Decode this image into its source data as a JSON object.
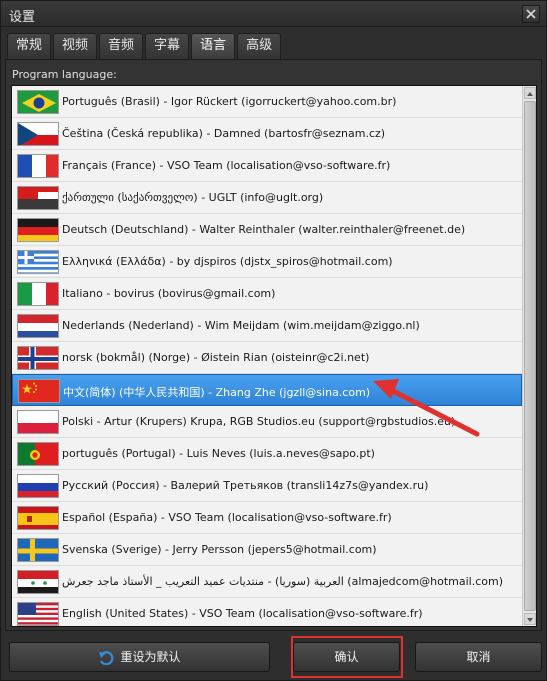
{
  "window": {
    "title": "设置"
  },
  "tabs": [
    {
      "label": "常规",
      "active": false
    },
    {
      "label": "视频",
      "active": false
    },
    {
      "label": "音频",
      "active": false
    },
    {
      "label": "字幕",
      "active": false
    },
    {
      "label": "语言",
      "active": true
    },
    {
      "label": "高级",
      "active": false
    }
  ],
  "panel": {
    "group_label": "Program language:"
  },
  "languages": [
    {
      "label": "Português (Brasil) - Igor Rückert (igorruckert@yahoo.com.br)",
      "flag": "brazil-flag-icon"
    },
    {
      "label": "Čeština (Česká republika) - Damned (bartosfr@seznam.cz)",
      "flag": "czech-flag-icon"
    },
    {
      "label": "Français (France) - VSO Team (localisation@vso-software.fr)",
      "flag": "france-flag-icon"
    },
    {
      "label": "ქართული (საქართველო) - UGLT (info@uglt.org)",
      "flag": "georgia-flag-icon"
    },
    {
      "label": "Deutsch (Deutschland) - Walter Reinthaler (walter.reinthaler@freenet.de)",
      "flag": "germany-flag-icon"
    },
    {
      "label": "Ελληνικά (Ελλάδα) - by djspiros (djstx_spiros@hotmail.com)",
      "flag": "greece-flag-icon"
    },
    {
      "label": "Italiano - bovirus (bovirus@gmail.com)",
      "flag": "italy-flag-icon"
    },
    {
      "label": "Nederlands (Nederland) - Wim Meijdam (wim.meijdam@ziggo.nl)",
      "flag": "netherlands-flag-icon"
    },
    {
      "label": "norsk (bokmål) (Norge) - Øistein Rian (oisteinr@c2i.net)",
      "flag": "norway-flag-icon"
    },
    {
      "label": "中文(简体) (中华人民共和国) - Zhang Zhe (jgzll@sina.com)",
      "flag": "china-flag-icon",
      "selected": true
    },
    {
      "label": "Polski - Artur (Krupers) Krupa, RGB Studios.eu (support@rgbstudios.eu)",
      "flag": "poland-flag-icon"
    },
    {
      "label": "português (Portugal) - Luis Neves (luis.a.neves@sapo.pt)",
      "flag": "portugal-flag-icon"
    },
    {
      "label": "Русский (Россия) - Валерий Третьяков (transli14z7s@yandex.ru)",
      "flag": "russia-flag-icon"
    },
    {
      "label": "Español (España) - VSO Team (localisation@vso-software.fr)",
      "flag": "spain-flag-icon"
    },
    {
      "label": "Svenska (Sverige) - Jerry Persson (jepers5@hotmail.com)",
      "flag": "sweden-flag-icon"
    },
    {
      "label": "العربية (سوريا) - منتديات عميد التعريب _ الأستاذ ماجد جعرش (almajedcom@hotmail.com)",
      "flag": "syria-flag-icon"
    },
    {
      "label": "English (United States) - VSO Team (localisation@vso-software.fr)",
      "flag": "usa-flag-icon"
    }
  ],
  "footer": {
    "reset_label": "重设为默认",
    "ok_label": "确认",
    "cancel_label": "取消"
  },
  "colors": {
    "selection": "#3a8ee6",
    "annotation": "#e03131"
  }
}
